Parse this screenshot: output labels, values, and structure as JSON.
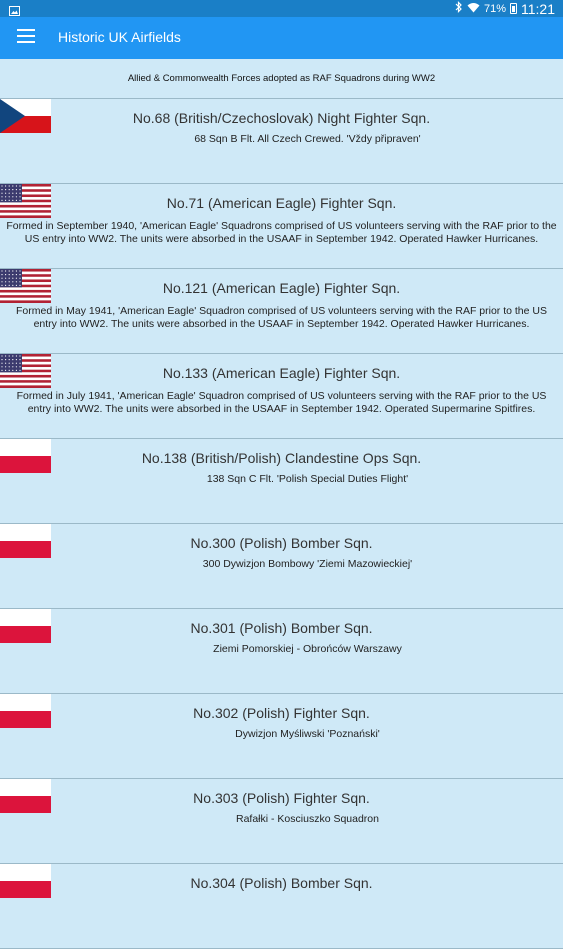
{
  "status_bar": {
    "battery": "71%",
    "time": "11:21"
  },
  "app_bar": {
    "title": "Historic UK Airfields"
  },
  "header": {
    "text": "Allied & Commonwealth Forces adopted as RAF Squadrons during WW2"
  },
  "squadrons": [
    {
      "flag": "czech",
      "title": "No.68 (British/Czechoslovak) Night Fighter Sqn.",
      "desc": "68 Sqn B Flt. All Czech Crewed. 'Vždy připraven'"
    },
    {
      "flag": "usa",
      "title": "No.71 (American Eagle) Fighter Sqn.",
      "desc": "Formed in September 1940, 'American Eagle' Squadrons comprised of US volunteers serving with the RAF prior to the US entry into WW2.  The units were absorbed in the USAAF in September 1942.  Operated Hawker Hurricanes."
    },
    {
      "flag": "usa",
      "title": "No.121 (American Eagle) Fighter Sqn.",
      "desc": "Formed in May 1941, 'American Eagle' Squadron comprised of US volunteers serving with the RAF prior to the US entry into WW2.  The units were absorbed in the USAAF in September 1942.  Operated Hawker Hurricanes."
    },
    {
      "flag": "usa",
      "title": "No.133 (American Eagle) Fighter Sqn.",
      "desc": "Formed in July 1941, 'American Eagle' Squadron comprised of US volunteers serving with the RAF prior to the US entry into WW2.  The units were absorbed in the USAAF in September 1942.  Operated Supermarine Spitfires."
    },
    {
      "flag": "poland",
      "title": "No.138 (British/Polish) Clandestine Ops Sqn.",
      "desc": "138 Sqn C Flt. 'Polish Special Duties Flight'"
    },
    {
      "flag": "poland",
      "title": "No.300 (Polish) Bomber Sqn.",
      "desc": "300 Dywizjon Bombowy 'Ziemi Mazowieckiej'"
    },
    {
      "flag": "poland",
      "title": "No.301 (Polish) Bomber Sqn.",
      "desc": "Ziemi Pomorskiej - Obrońców Warszawy"
    },
    {
      "flag": "poland",
      "title": "No.302 (Polish) Fighter Sqn.",
      "desc": "Dywizjon Myśliwski 'Poznański'"
    },
    {
      "flag": "poland",
      "title": "No.303 (Polish) Fighter Sqn.",
      "desc": "Rafałki - Kosciuszko Squadron"
    },
    {
      "flag": "poland",
      "title": "No.304 (Polish) Bomber Sqn.",
      "desc": ""
    }
  ]
}
